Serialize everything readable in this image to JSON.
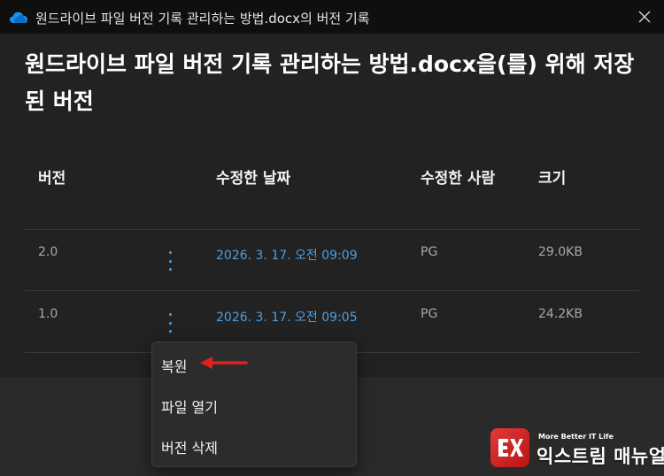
{
  "window": {
    "title": "원드라이브 파일 버전 기록 관리하는 방법.docx의 버전 기록",
    "icon": "onedrive-cloud-icon",
    "close_icon": "close-icon"
  },
  "dialog": {
    "heading_line1": "원드라이브 파일 버전 기록 관리하는 방법.docx을(를) 위해 저장",
    "heading_line2": "된 버전",
    "columns": [
      "버전",
      "수정한 날짜",
      "수정한 사람",
      "크기"
    ],
    "rows": [
      {
        "version": "2.0",
        "date": "2026. 3. 17. 오전 09:09",
        "modified_by": "PG",
        "size": "29.0KB"
      },
      {
        "version": "1.0",
        "date": "2026. 3. 17. 오전 09:05",
        "modified_by": "PG",
        "size": "24.2KB"
      }
    ]
  },
  "context_menu": {
    "items": [
      "복원",
      "파일 열기",
      "버전 삭제"
    ]
  },
  "watermark": {
    "tagline": "More Better IT Life",
    "name": "익스트림 매뉴얼",
    "logo_text": "EX"
  },
  "colors": {
    "accent": "#4aa0e6",
    "arrow": "#e0201c",
    "logo": "#d32a2a"
  }
}
